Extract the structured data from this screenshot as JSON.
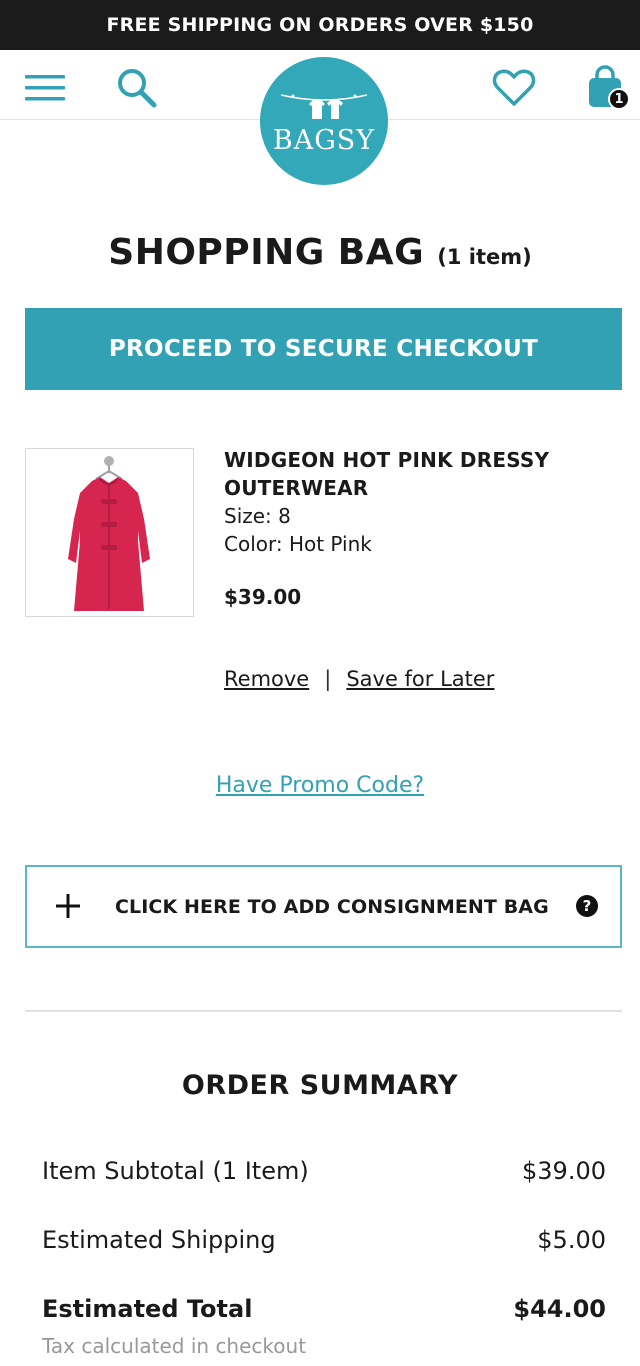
{
  "promo_bar": {
    "text": "FREE SHIPPING ON ORDERS OVER $150"
  },
  "header": {
    "logo_text": "BAGSY",
    "icons": [
      "menu-icon",
      "search-icon",
      "heart-icon",
      "shopping-bag-icon"
    ],
    "cart_count": "1"
  },
  "page": {
    "title": "SHOPPING BAG",
    "item_count": "(1 item)",
    "checkout_label": "PROCEED TO SECURE CHECKOUT"
  },
  "cart_item": {
    "name": "WIDGEON HOT PINK DRESSY OUTERWEAR",
    "size": "Size: 8",
    "color": "Color: Hot Pink",
    "price": "$39.00",
    "remove_label": "Remove",
    "separator": "|",
    "save_label": "Save for Later"
  },
  "promo": {
    "link_label": "Have Promo Code?"
  },
  "consignment": {
    "label": "CLICK HERE TO ADD CONSIGNMENT BAG",
    "help": "?"
  },
  "summary": {
    "title": "ORDER SUMMARY",
    "rows": [
      {
        "label": "Item Subtotal (1 Item)",
        "value": "$39.00"
      },
      {
        "label": "Estimated Shipping",
        "value": "$5.00"
      },
      {
        "label": "Estimated Total",
        "value": "$44.00"
      }
    ],
    "tax_note": "Tax calculated in checkout"
  },
  "colors": {
    "accent": "#32a1b3",
    "logo": "#32a8b8",
    "promo_bar": "#1b1b1b",
    "coat": "#d6264f"
  }
}
